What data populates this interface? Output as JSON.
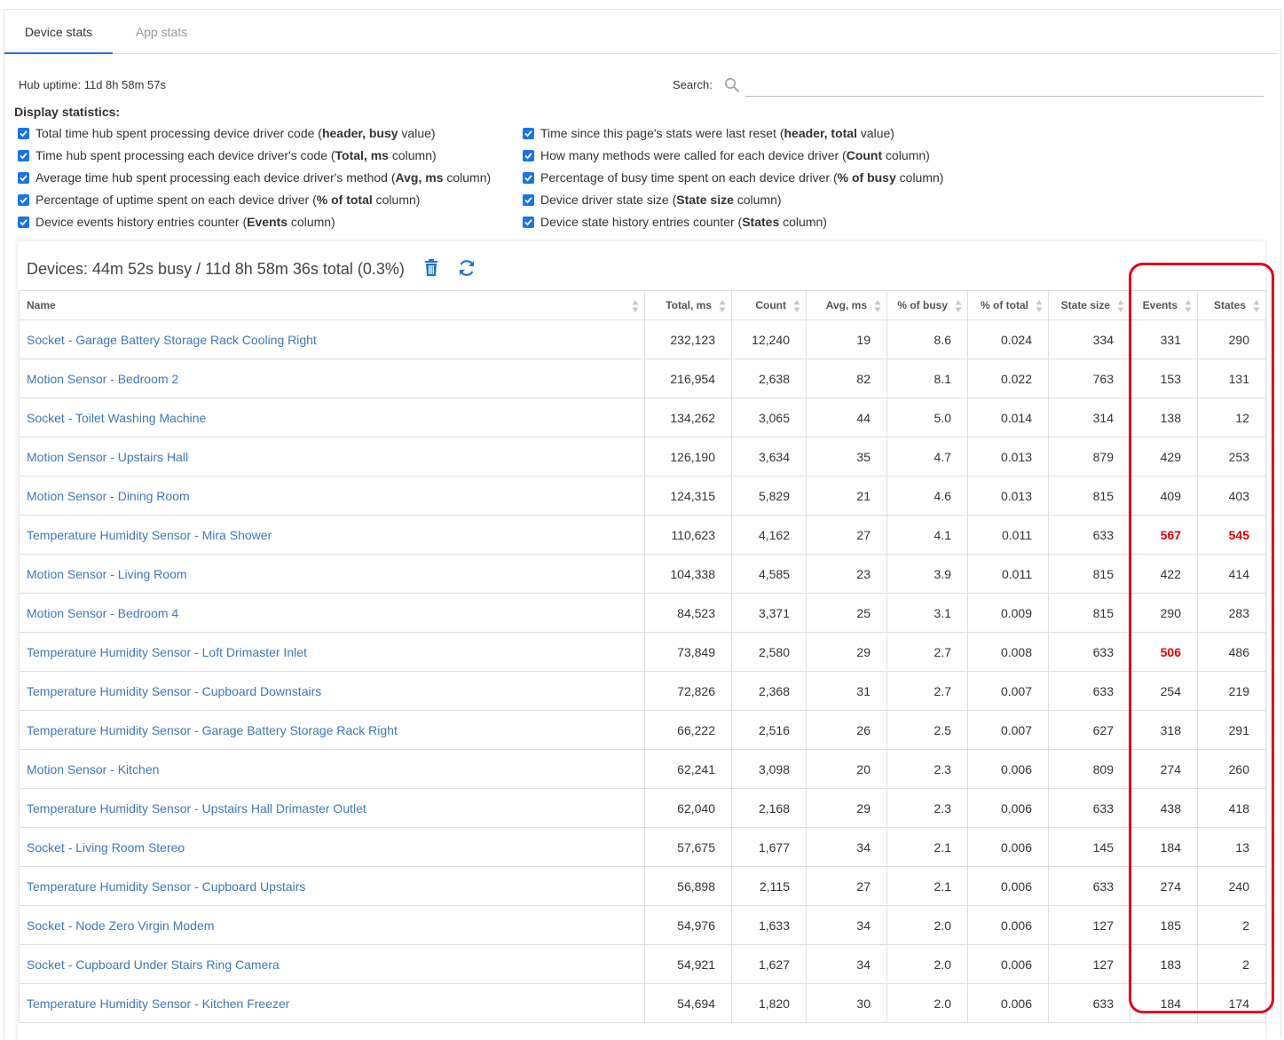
{
  "tabs": [
    {
      "label": "Device stats",
      "active": true
    },
    {
      "label": "App stats",
      "active": false
    }
  ],
  "uptime": "Hub uptime: 11d 8h 58m 57s",
  "search": {
    "label": "Search:",
    "placeholder": "",
    "value": ""
  },
  "display_title": "Display statistics:",
  "options_left": [
    {
      "pre": "Total time hub spent processing device driver code (",
      "bold": "header, busy",
      "post": " value)"
    },
    {
      "pre": "Time hub spent processing each device driver's code (",
      "bold": "Total, ms",
      "post": " column)"
    },
    {
      "pre": "Average time hub spent processing each device driver's method (",
      "bold": "Avg, ms",
      "post": " column)"
    },
    {
      "pre": "Percentage of uptime spent on each device driver (",
      "bold": "% of total",
      "post": " column)"
    },
    {
      "pre": "Device events history entries counter (",
      "bold": "Events",
      "post": " column)"
    }
  ],
  "options_right": [
    {
      "pre": "Time since this page's stats were last reset (",
      "bold": "header, total",
      "post": " value)"
    },
    {
      "pre": "How many methods were called for each device driver (",
      "bold": "Count",
      "post": " column)"
    },
    {
      "pre": "Percentage of busy time spent on each device driver (",
      "bold": "% of busy",
      "post": " column)"
    },
    {
      "pre": "Device driver state size (",
      "bold": "State size",
      "post": " column)"
    },
    {
      "pre": "Device state history entries counter (",
      "bold": "States",
      "post": " column)"
    }
  ],
  "card_title": "Devices: 44m 52s busy / 11d 8h 58m 36s total (0.3%)",
  "columns": [
    "Name",
    "Total, ms",
    "Count",
    "Avg, ms",
    "% of busy",
    "% of total",
    "State size",
    "Events",
    "States"
  ],
  "rows": [
    {
      "name": "Socket - Garage Battery Storage Rack Cooling Right",
      "total": "232,123",
      "count": "12,240",
      "avg": "19",
      "busy": "8.6",
      "pct_total": "0.024",
      "state_size": "334",
      "events": "331",
      "states": "290",
      "events_red": false,
      "states_red": false
    },
    {
      "name": "Motion Sensor - Bedroom 2",
      "total": "216,954",
      "count": "2,638",
      "avg": "82",
      "busy": "8.1",
      "pct_total": "0.022",
      "state_size": "763",
      "events": "153",
      "states": "131",
      "events_red": false,
      "states_red": false
    },
    {
      "name": "Socket - Toilet Washing Machine",
      "total": "134,262",
      "count": "3,065",
      "avg": "44",
      "busy": "5.0",
      "pct_total": "0.014",
      "state_size": "314",
      "events": "138",
      "states": "12",
      "events_red": false,
      "states_red": false
    },
    {
      "name": "Motion Sensor - Upstairs Hall",
      "total": "126,190",
      "count": "3,634",
      "avg": "35",
      "busy": "4.7",
      "pct_total": "0.013",
      "state_size": "879",
      "events": "429",
      "states": "253",
      "events_red": false,
      "states_red": false
    },
    {
      "name": "Motion Sensor - Dining Room",
      "total": "124,315",
      "count": "5,829",
      "avg": "21",
      "busy": "4.6",
      "pct_total": "0.013",
      "state_size": "815",
      "events": "409",
      "states": "403",
      "events_red": false,
      "states_red": false
    },
    {
      "name": "Temperature Humidity Sensor - Mira Shower",
      "total": "110,623",
      "count": "4,162",
      "avg": "27",
      "busy": "4.1",
      "pct_total": "0.011",
      "state_size": "633",
      "events": "567",
      "states": "545",
      "events_red": true,
      "states_red": true
    },
    {
      "name": "Motion Sensor - Living Room",
      "total": "104,338",
      "count": "4,585",
      "avg": "23",
      "busy": "3.9",
      "pct_total": "0.011",
      "state_size": "815",
      "events": "422",
      "states": "414",
      "events_red": false,
      "states_red": false
    },
    {
      "name": "Motion Sensor - Bedroom 4",
      "total": "84,523",
      "count": "3,371",
      "avg": "25",
      "busy": "3.1",
      "pct_total": "0.009",
      "state_size": "815",
      "events": "290",
      "states": "283",
      "events_red": false,
      "states_red": false
    },
    {
      "name": "Temperature Humidity Sensor - Loft Drimaster Inlet",
      "total": "73,849",
      "count": "2,580",
      "avg": "29",
      "busy": "2.7",
      "pct_total": "0.008",
      "state_size": "633",
      "events": "506",
      "states": "486",
      "events_red": true,
      "states_red": false
    },
    {
      "name": "Temperature Humidity Sensor - Cupboard Downstairs",
      "total": "72,826",
      "count": "2,368",
      "avg": "31",
      "busy": "2.7",
      "pct_total": "0.007",
      "state_size": "633",
      "events": "254",
      "states": "219",
      "events_red": false,
      "states_red": false
    },
    {
      "name": "Temperature Humidity Sensor - Garage Battery Storage Rack Right",
      "total": "66,222",
      "count": "2,516",
      "avg": "26",
      "busy": "2.5",
      "pct_total": "0.007",
      "state_size": "627",
      "events": "318",
      "states": "291",
      "events_red": false,
      "states_red": false
    },
    {
      "name": "Motion Sensor - Kitchen",
      "total": "62,241",
      "count": "3,098",
      "avg": "20",
      "busy": "2.3",
      "pct_total": "0.006",
      "state_size": "809",
      "events": "274",
      "states": "260",
      "events_red": false,
      "states_red": false
    },
    {
      "name": "Temperature Humidity Sensor - Upstairs Hall Drimaster Outlet",
      "total": "62,040",
      "count": "2,168",
      "avg": "29",
      "busy": "2.3",
      "pct_total": "0.006",
      "state_size": "633",
      "events": "438",
      "states": "418",
      "events_red": false,
      "states_red": false
    },
    {
      "name": "Socket - Living Room Stereo",
      "total": "57,675",
      "count": "1,677",
      "avg": "34",
      "busy": "2.1",
      "pct_total": "0.006",
      "state_size": "145",
      "events": "184",
      "states": "13",
      "events_red": false,
      "states_red": false
    },
    {
      "name": "Temperature Humidity Sensor - Cupboard Upstairs",
      "total": "56,898",
      "count": "2,115",
      "avg": "27",
      "busy": "2.1",
      "pct_total": "0.006",
      "state_size": "633",
      "events": "274",
      "states": "240",
      "events_red": false,
      "states_red": false
    },
    {
      "name": "Socket - Node Zero Virgin Modem",
      "total": "54,976",
      "count": "1,633",
      "avg": "34",
      "busy": "2.0",
      "pct_total": "0.006",
      "state_size": "127",
      "events": "185",
      "states": "2",
      "events_red": false,
      "states_red": false
    },
    {
      "name": "Socket - Cupboard Under Stairs Ring Camera",
      "total": "54,921",
      "count": "1,627",
      "avg": "34",
      "busy": "2.0",
      "pct_total": "0.006",
      "state_size": "127",
      "events": "183",
      "states": "2",
      "events_red": false,
      "states_red": false
    },
    {
      "name": "Temperature Humidity Sensor - Kitchen Freezer",
      "total": "54,694",
      "count": "1,820",
      "avg": "30",
      "busy": "2.0",
      "pct_total": "0.006",
      "state_size": "633",
      "events": "184",
      "states": "174",
      "events_red": false,
      "states_red": false
    }
  ],
  "colors": {
    "accent": "#1976d2",
    "link": "#3c78b8",
    "checkbox": "#1a73e8",
    "highlight_red": "#e00000",
    "annotation_red": "#e0001b"
  },
  "icons": [
    "search-icon",
    "checkbox-checked-icon",
    "trash-icon",
    "refresh-icon",
    "sort-icon"
  ]
}
